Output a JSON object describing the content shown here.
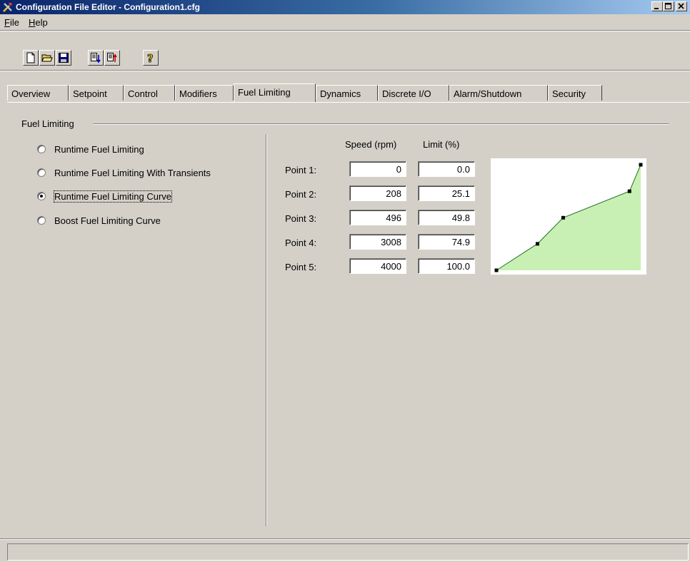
{
  "window": {
    "title": "Configuration File Editor - Configuration1.cfg",
    "app_icon": "tools-icon",
    "controls": [
      "minimize-icon",
      "maximize-icon",
      "close-icon"
    ]
  },
  "menu": [
    {
      "label": "File",
      "mnemonic": "F"
    },
    {
      "label": "Help",
      "mnemonic": "H"
    }
  ],
  "toolbar": {
    "buttons": [
      "new-file-icon",
      "open-folder-icon",
      "save-icon",
      "upload-icon",
      "download-icon",
      "help-icon"
    ]
  },
  "tabs": [
    "Overview",
    "Setpoint",
    "Control",
    "Modifiers",
    "Fuel Limiting",
    "Dynamics",
    "Discrete I/O",
    "Alarm/Shutdown",
    "Security"
  ],
  "active_tab": "Fuel Limiting",
  "group": {
    "title": "Fuel Limiting",
    "options": [
      {
        "label": "Runtime Fuel Limiting",
        "selected": false
      },
      {
        "label": "Runtime Fuel Limiting With Transients",
        "selected": false
      },
      {
        "label": "Runtime Fuel Limiting Curve",
        "selected": true
      },
      {
        "label": "Boost Fuel Limiting Curve",
        "selected": false
      }
    ]
  },
  "curve_table": {
    "col_speed": "Speed (rpm)",
    "col_limit": "Limit (%)",
    "points": [
      {
        "label": "Point 1:",
        "speed": "0",
        "limit": "0.0"
      },
      {
        "label": "Point 2:",
        "speed": "208",
        "limit": "25.1"
      },
      {
        "label": "Point 3:",
        "speed": "496",
        "limit": "49.8"
      },
      {
        "label": "Point 4:",
        "speed": "3008",
        "limit": "74.9"
      },
      {
        "label": "Point 5:",
        "speed": "4000",
        "limit": "100.0"
      }
    ]
  },
  "chart_data": {
    "type": "area",
    "x": [
      0,
      208,
      496,
      3008,
      4000
    ],
    "y": [
      0,
      25.1,
      49.8,
      74.9,
      100
    ],
    "xlim": [
      0,
      4000
    ],
    "ylim": [
      0,
      100
    ],
    "fill_color": "#c8f0b4",
    "line_color": "#207020",
    "point_color": "#000000",
    "background": "#ffffff"
  },
  "statusbar": {
    "text": ""
  }
}
